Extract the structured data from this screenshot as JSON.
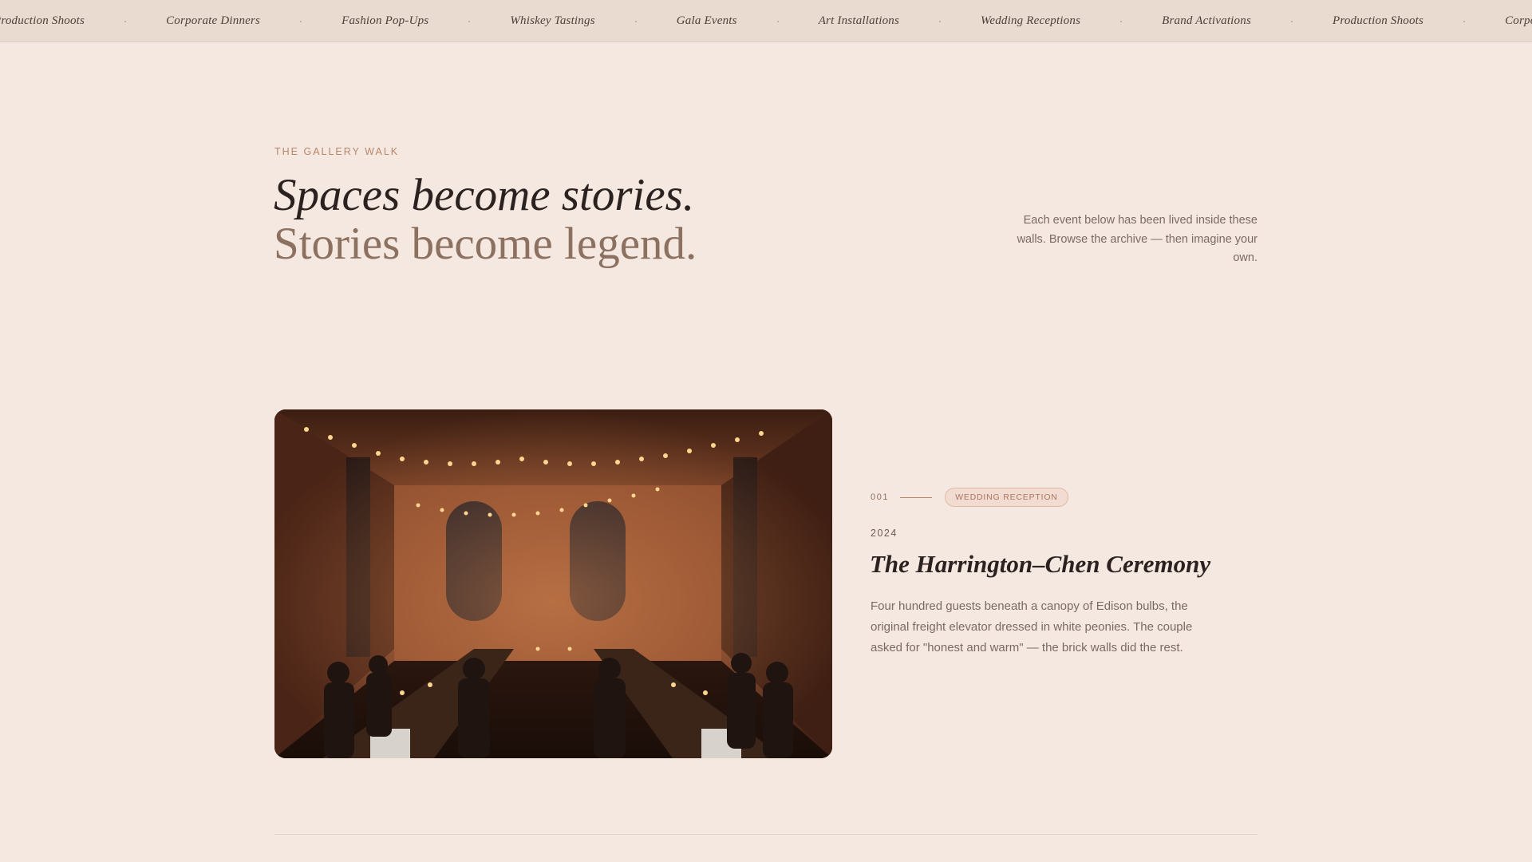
{
  "marquee": {
    "items": [
      "Production Shoots",
      "Corporate Dinners",
      "Fashion Pop-Ups",
      "Whiskey Tastings",
      "Gala Events",
      "Art Installations",
      "Wedding Receptions",
      "Brand Activations",
      "Production Shoots",
      "Corporate Dinners"
    ]
  },
  "hero": {
    "eyebrow": "THE GALLERY WALK",
    "headline_line1": "Spaces become stories.",
    "headline_line2": "Stories become legend.",
    "intro": "Each event below has been lived inside these walls. Browse the archive — then imagine your own."
  },
  "event": {
    "number": "001",
    "tag": "WEDDING RECEPTION",
    "year": "2024",
    "title": "The Harrington–Chen Ceremony",
    "description": "Four hundred guests beneath a canopy of Edison bulbs, the original freight elevator dressed in white peonies. The couple asked for \"honest and warm\" — the brick walls did the rest.",
    "photo_subject": "candlelit long-table dinner in brick loft under string lights"
  },
  "colors": {
    "background": "#f4e8e0",
    "marquee_bar": "#eadbd0",
    "accent": "#b9866a",
    "heading": "#2b2220",
    "muted": "#8c7060"
  }
}
